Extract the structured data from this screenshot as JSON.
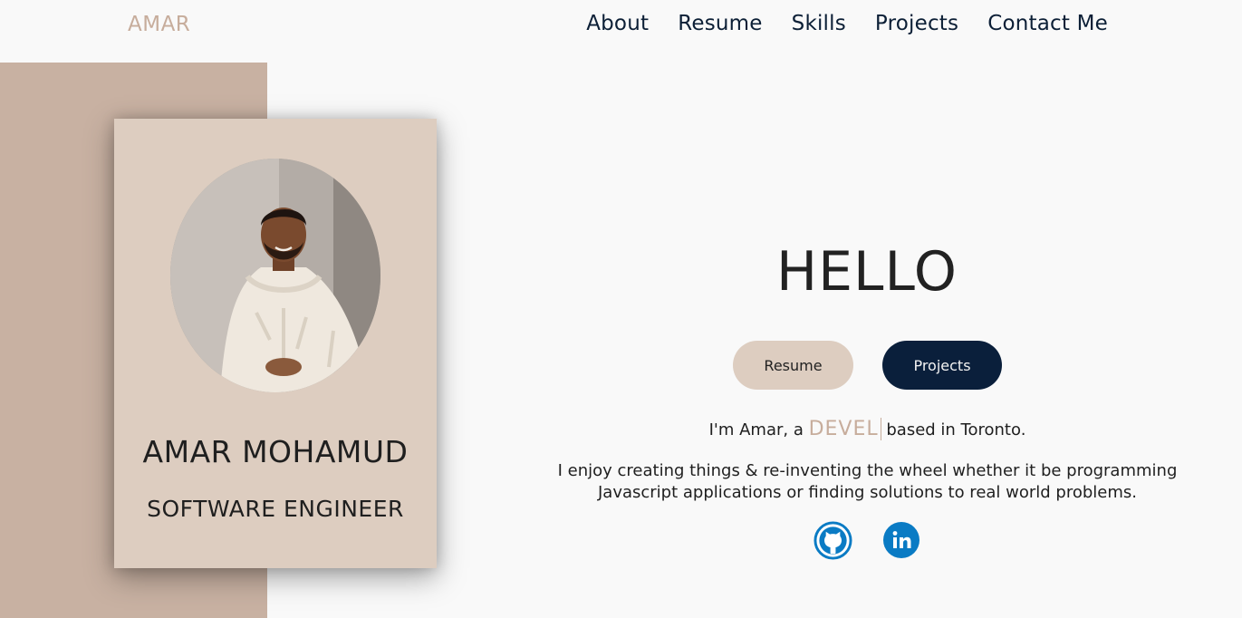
{
  "header": {
    "logo": "AMAR",
    "nav": [
      "About",
      "Resume",
      "Skills",
      "Projects",
      "Contact Me"
    ]
  },
  "profile": {
    "name": "AMAR MOHAMUD",
    "role": "SOFTWARE ENGINEER"
  },
  "hero": {
    "greeting": "HELLO",
    "resume_button": "Resume",
    "projects_button": "Projects",
    "intro_prefix": "I'm Amar, a",
    "intro_typed": "DEVEL",
    "intro_suffix": "based in Toronto.",
    "bio_line1": "I enjoy creating things & re-inventing the wheel whether it be programming",
    "bio_line2": "Javascript applications or finding solutions to real world problems."
  },
  "social": {
    "github_icon": "github-icon",
    "linkedin_icon": "linkedin-icon"
  },
  "colors": {
    "accent": "#c7ad9c",
    "navy": "#0a1f3b",
    "card": "#ddcdc0",
    "band": "#c8b1a2",
    "social_blue": "#0a7bc4"
  }
}
